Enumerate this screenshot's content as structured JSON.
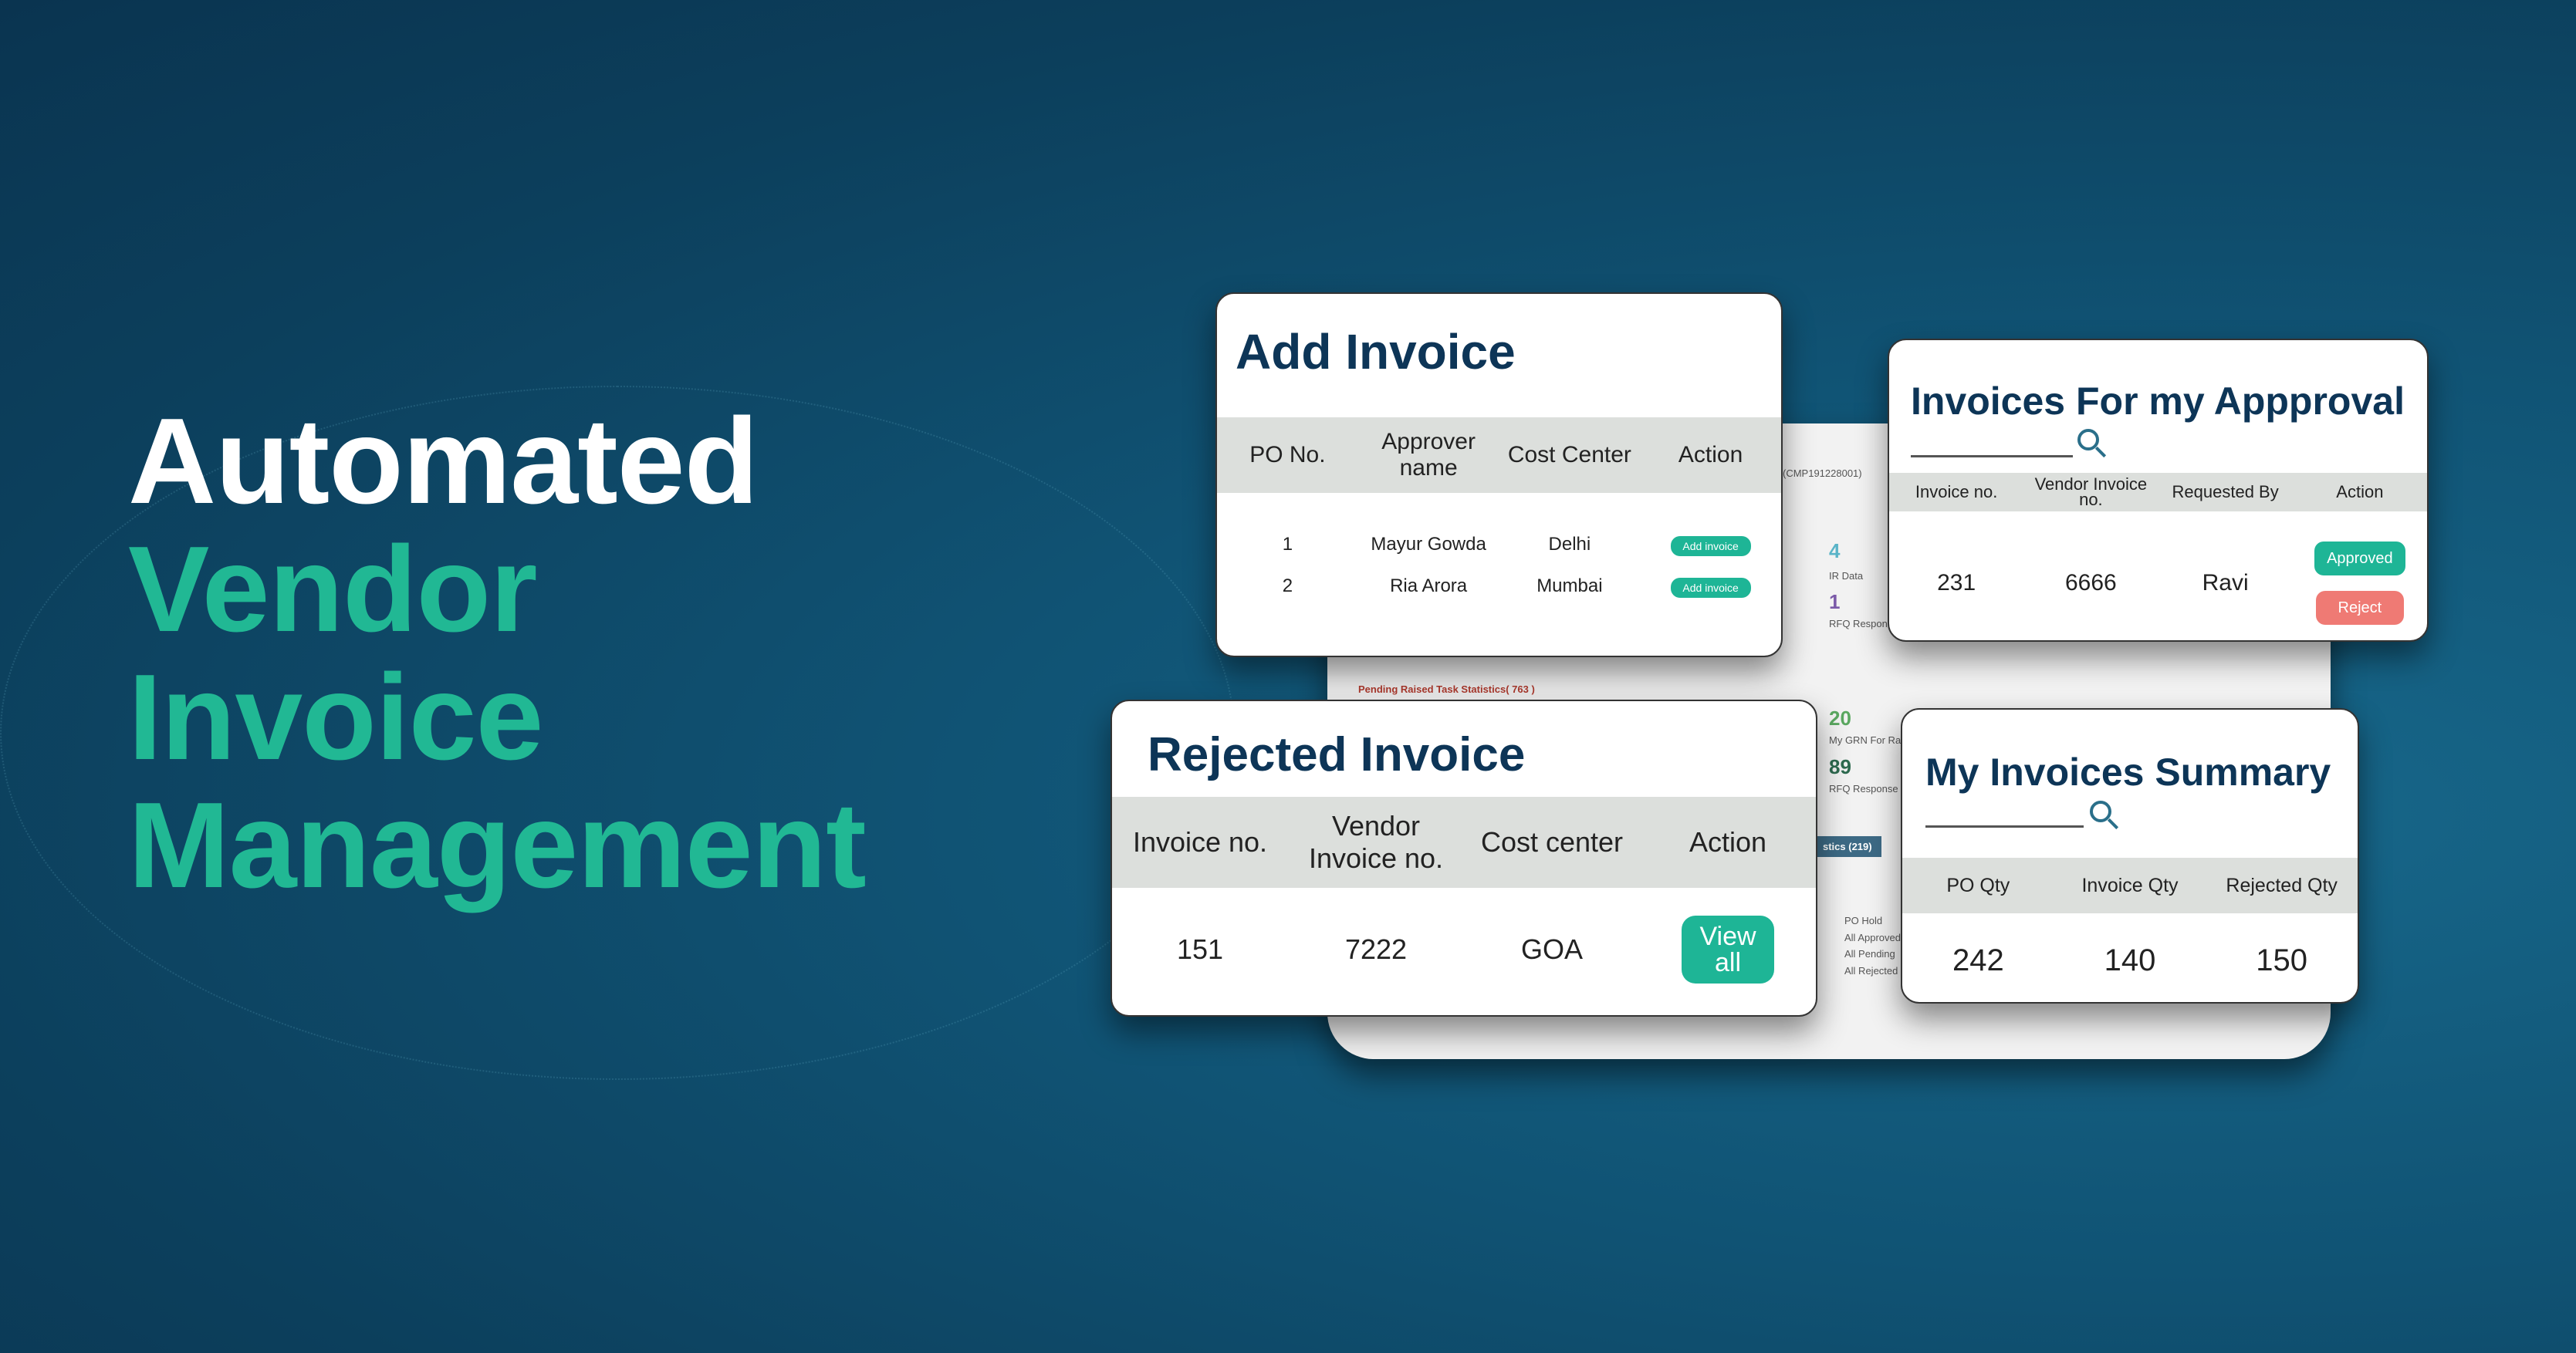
{
  "headline": {
    "line1": "Automated",
    "line2": "Vendor",
    "line3": "Invoice",
    "line4": "Management"
  },
  "colors": {
    "accent": "#21b894",
    "title": "#0d3557",
    "reject": "#ef7a74",
    "background": "#105374"
  },
  "dashboard": {
    "company": "(CMP191228001)",
    "stat1_value": "4",
    "stat1_label": "IR Data",
    "stat2_value": "1",
    "stat2_label": "RFQ Response",
    "stat3_value": "20",
    "stat3_label": "My GRN For Raise",
    "stat4_value": "89",
    "stat4_label": "RFQ Response",
    "pending": "Pending Raised Task Statistics( 763 )",
    "stats_bar": "stics (219)",
    "legend": [
      "PO Hold",
      "All Approved",
      "All Pending",
      "All Rejected"
    ]
  },
  "add_invoice": {
    "title": "Add Invoice",
    "headers": [
      "PO No.",
      "Approver name",
      "Cost Center",
      "Action"
    ],
    "rows": [
      {
        "po": "1",
        "approver": "Mayur Gowda",
        "center": "Delhi",
        "action": "Add invoice"
      },
      {
        "po": "2",
        "approver": "Ria Arora",
        "center": "Mumbai",
        "action": "Add invoice"
      }
    ]
  },
  "approval": {
    "title": "Invoices For my Appproval",
    "headers": [
      "Invoice no.",
      "Vendor Invoice no.",
      "Requested By",
      "Action"
    ],
    "row": {
      "invoice": "231",
      "vendor": "6666",
      "by": "Ravi"
    },
    "approve": "Approved",
    "reject": "Reject"
  },
  "rejected": {
    "title": "Rejected Invoice",
    "headers": [
      "Invoice no.",
      "Vendor Invoice no.",
      "Cost center",
      "Action"
    ],
    "row": {
      "invoice": "151",
      "vendor": "7222",
      "center": "GOA"
    },
    "action": "View all"
  },
  "summary": {
    "title": "My Invoices Summary",
    "headers": [
      "PO Qty",
      "Invoice Qty",
      "Rejected Qty"
    ],
    "values": [
      "242",
      "140",
      "150"
    ]
  }
}
